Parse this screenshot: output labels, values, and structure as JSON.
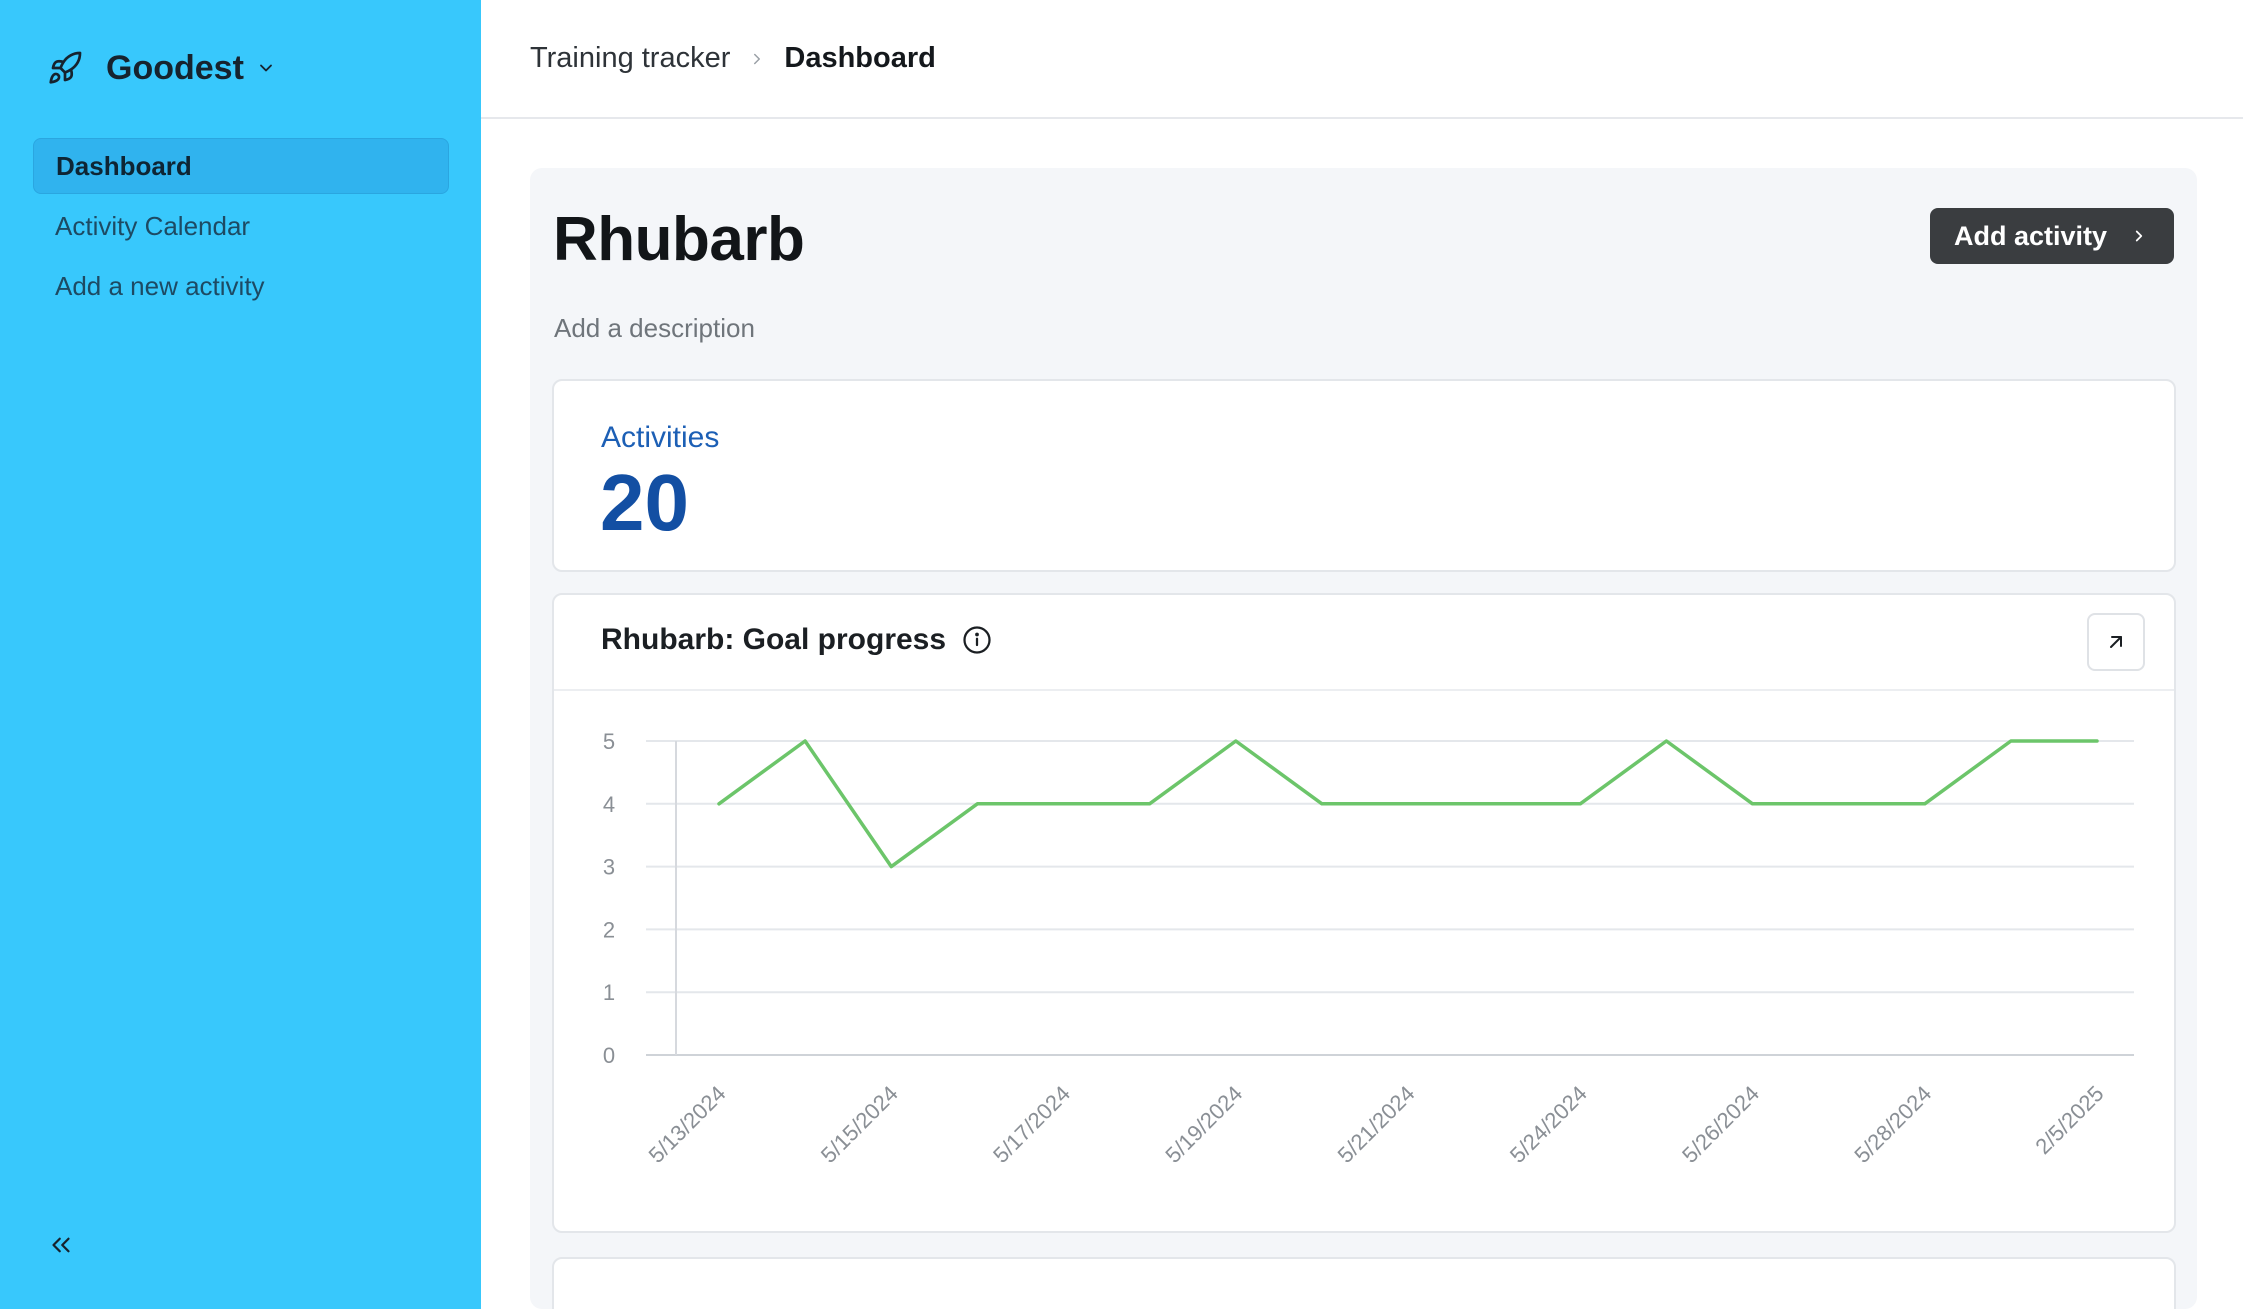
{
  "sidebar": {
    "brand_name": "Goodest",
    "brand_icon": "rocket-icon",
    "items": [
      {
        "label": "Dashboard",
        "active": true
      },
      {
        "label": "Activity Calendar",
        "active": false
      },
      {
        "label": "Add a new activity",
        "active": false
      }
    ],
    "collapse_icon": "chevrons-left-icon",
    "background": "#38c8fc"
  },
  "breadcrumb": {
    "parent": "Training tracker",
    "current": "Dashboard"
  },
  "page": {
    "title": "Rhubarb",
    "description": "Add a description",
    "add_button_label": "Add activity"
  },
  "stats": {
    "label": "Activities",
    "value": "20",
    "accent": "#134fa3"
  },
  "chart_card": {
    "title": "Rhubarb: Goal progress"
  },
  "chart_data": {
    "type": "line",
    "x": [
      "5/13/2024",
      "5/14/2024",
      "5/15/2024",
      "5/16/2024",
      "5/17/2024",
      "5/18/2024",
      "5/19/2024",
      "5/20/2024",
      "5/21/2024",
      "5/22/2024",
      "5/24/2024",
      "5/25/2024",
      "5/26/2024",
      "5/27/2024",
      "5/28/2024",
      "5/29/2024",
      "2/5/2025"
    ],
    "tick_labels": [
      "5/13/2024",
      "5/15/2024",
      "5/17/2024",
      "5/19/2024",
      "5/21/2024",
      "5/24/2024",
      "5/26/2024",
      "5/28/2024",
      "2/5/2025"
    ],
    "series": [
      {
        "values": [
          4,
          5,
          3,
          4,
          4,
          4,
          5,
          4,
          4,
          4,
          4,
          5,
          4,
          4,
          4,
          5,
          5
        ],
        "color": "#6cc56a"
      }
    ],
    "ylim": [
      0,
      5
    ],
    "yticks": [
      0,
      1,
      2,
      3,
      4,
      5
    ],
    "grid": true
  }
}
